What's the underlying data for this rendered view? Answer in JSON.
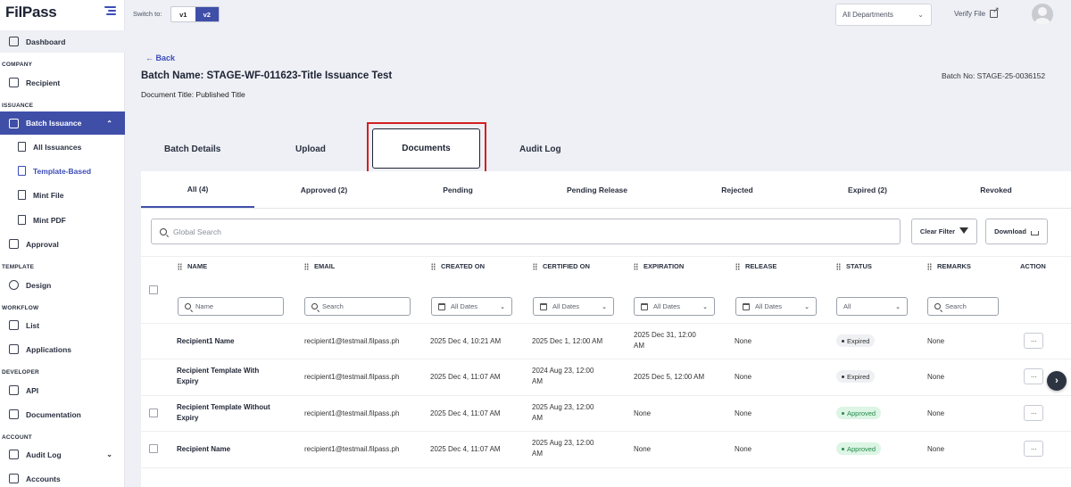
{
  "app": {
    "logo": "FilPass"
  },
  "sidebar": {
    "dashboard": "Dashboard",
    "company_label": "COMPANY",
    "recipient": "Recipient",
    "issuance_label": "ISSUANCE",
    "batch_issuance": "Batch Issuance",
    "all_issuances": "All Issuances",
    "template_based": "Template-Based",
    "mint_file": "Mint File",
    "mint_pdf": "Mint PDF",
    "approval": "Approval",
    "template_label": "TEMPLATE",
    "design": "Design",
    "workflow_label": "WORKFLOW",
    "list": "List",
    "applications": "Applications",
    "developer_label": "DEVELOPER",
    "api": "API",
    "documentation": "Documentation",
    "account_label": "ACCOUNT",
    "audit_log": "Audit Log",
    "accounts": "Accounts"
  },
  "topbar": {
    "switch_label": "Switch to:",
    "v1": "v1",
    "v2": "v2",
    "department": "All Departments",
    "verify_file": "Verify File"
  },
  "header": {
    "back": "← Back",
    "batch_name": "Batch Name: STAGE-WF-011623-Title Issuance Test",
    "document_title": "Document Title: Published Title",
    "batch_no": "Batch No: STAGE-25-0036152"
  },
  "main_tabs": [
    "Batch Details",
    "Upload",
    "Documents",
    "Audit Log"
  ],
  "sub_tabs": [
    "All (4)",
    "Approved (2)",
    "Pending",
    "Pending Release",
    "Rejected",
    "Expired (2)",
    "Revoked"
  ],
  "toolbar": {
    "search_placeholder": "Global Search",
    "clear_filter": "Clear Filter",
    "download": "Download"
  },
  "table": {
    "columns": [
      "NAME",
      "EMAIL",
      "CREATED ON",
      "CERTIFIED ON",
      "EXPIRATION",
      "RELEASE",
      "STATUS",
      "REMARKS",
      "ACTION"
    ],
    "filters": {
      "name": "Name",
      "email": "Search",
      "created_on": "All Dates",
      "certified_on": "All Dates",
      "expiration": "All Dates",
      "release": "All Dates",
      "status": "All",
      "remarks": "Search"
    },
    "rows": [
      {
        "name": "Recipient1 Name",
        "email": "recipient1@testmail.filpass.ph",
        "created_on": "2025 Dec 4, 10:21 AM",
        "certified_on": "2025 Dec 1, 12:00 AM",
        "expiration": "2025 Dec 31, 12:00 AM",
        "release": "None",
        "status": "Expired",
        "remarks": "None",
        "action": "···"
      },
      {
        "name": "Recipient Template With Expiry",
        "email": "recipient1@testmail.filpass.ph",
        "created_on": "2025 Dec 4, 11:07 AM",
        "certified_on": "2024 Aug 23, 12:00 AM",
        "expiration": "2025 Dec 5, 12:00 AM",
        "release": "None",
        "status": "Expired",
        "remarks": "None",
        "action": "···"
      },
      {
        "name": "Recipient Template Without Expiry",
        "email": "recipient1@testmail.filpass.ph",
        "created_on": "2025 Dec 4, 11:07 AM",
        "certified_on": "2025 Aug 23, 12:00 AM",
        "expiration": "None",
        "release": "None",
        "status": "Approved",
        "remarks": "None",
        "action": "···"
      },
      {
        "name": "Recipient Name",
        "email": "recipient1@testmail.filpass.ph",
        "created_on": "2025 Dec 4, 11:07 AM",
        "certified_on": "2025 Aug 23, 12:00 AM",
        "expiration": "None",
        "release": "None",
        "status": "Approved",
        "remarks": "None",
        "action": "···"
      }
    ]
  },
  "colors": {
    "accent": "#3f4fa8",
    "highlight": "#d41f1f",
    "approved": "#248a4a"
  },
  "scroll_next": "›"
}
